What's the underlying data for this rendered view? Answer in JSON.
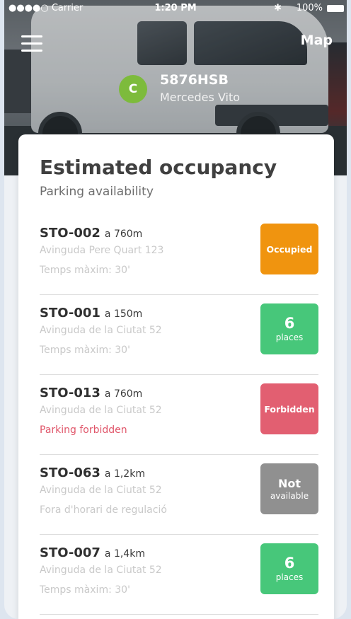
{
  "status_bar": {
    "carrier": "●●●●○ Carrier",
    "time": "1:20 PM",
    "bluetooth": "✱",
    "battery": "100%"
  },
  "header": {
    "menu_icon": "hamburger-icon",
    "map_label": "Map",
    "vehicle": {
      "badge": "C",
      "plate": "5876HSB",
      "model": "Mercedes Vito"
    }
  },
  "card": {
    "title": "Estimated occupancy",
    "subtitle": "Parking availability",
    "items": [
      {
        "code": "STO-002",
        "distance": "a 760m",
        "address": "Avinguda Pere Quart 123",
        "note": "Temps màxim: 30'",
        "status_main": "Occupied",
        "status_sub": "",
        "status_color": "#f0940f"
      },
      {
        "code": "STO-001",
        "distance": "a 150m",
        "address": "Avinguda de la Ciutat 52",
        "note": "Temps màxim: 30'",
        "status_main": "6",
        "status_sub": "places",
        "status_color": "#47c77a"
      },
      {
        "code": "STO-013",
        "distance": "a 760m",
        "address": "Avinguda de la Ciutat 52",
        "note": "Parking forbidden",
        "status_main": "Forbidden",
        "status_sub": "",
        "status_color": "#e25f71"
      },
      {
        "code": "STO-063",
        "distance": "a 1,2km",
        "address": "Avinguda de la Ciutat 52",
        "note": "Fora d'horari de regulació",
        "status_main": "Not",
        "status_sub": "available",
        "status_color": "#909090"
      },
      {
        "code": "STO-007",
        "distance": "a 1,4km",
        "address": "Avinguda de la Ciutat 52",
        "note": "Temps màxim: 30'",
        "status_main": "6",
        "status_sub": "places",
        "status_color": "#47c77a"
      }
    ]
  }
}
